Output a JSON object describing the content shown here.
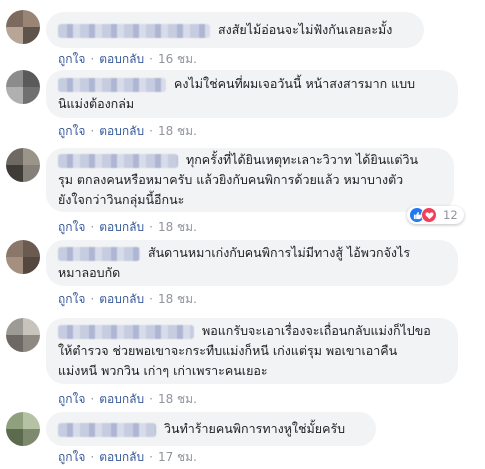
{
  "comments": [
    {
      "text": "สงสัยไม้อ่อนจะไม่ฟังกันเลยละมั้ง",
      "like_label": "ถูกใจ",
      "reply_label": "ตอบกลับ",
      "time": "16 ชม."
    },
    {
      "text_lines": [
        "คงไม่ใช่คนที่ผมเจอวันนี้ หน้าสงสารมาก แบบ",
        "นิแม่งต้องกล่ม"
      ],
      "like_label": "ถูกใจ",
      "reply_label": "ตอบกลับ",
      "time": "18 ชม."
    },
    {
      "text_lines": [
        "ทุกครั้งที่ได้ยินเหตุทะเลาะวิวาท ได้ยินแต่วิน",
        "รุม ตกลงคนหรือหมาครับ แล้วยิงกับคนพิการด้วยแล้ว หมาบางตัว",
        "ยังใจกว่าวินกลุ่มนี้อีกนะ"
      ],
      "like_label": "ถูกใจ",
      "reply_label": "ตอบกลับ",
      "time": "18 ชม.",
      "reaction_count": "12"
    },
    {
      "text_lines": [
        "สันดานหมาเก่งกับคนพิการไม่มีทางสู้ ไอ้พวกจังไร",
        "หมาลอบกัด"
      ],
      "like_label": "ถูกใจ",
      "reply_label": "ตอบกลับ",
      "time": "18 ชม."
    },
    {
      "text_lines": [
        "พอแกรับจะเอาเรื่องจะเถื่อนกลับแม่งก็ไปขอ",
        "ให้ตำรวจ ช่วยพอเขาจะกระทืบแม่งก็หนี เก่งแต่รุม พอเขาเอาคืน",
        "แม่งหนี พวกวิน เก่าๆ เก่าเพราะคนเยอะ"
      ],
      "like_label": "ถูกใจ",
      "reply_label": "ตอบกลับ",
      "time": "18 ชม."
    },
    {
      "text": "วินทำร้ายคนพิการทางหูใช่มั้ยครับ",
      "like_label": "ถูกใจ",
      "reply_label": "ตอบกลับ",
      "time": "17 ชม."
    }
  ],
  "colors": {
    "bubble": "#f2f3f5",
    "link": "#365899",
    "meta": "#90949c",
    "like_reaction": "#2078f4",
    "love_reaction": "#f33e58"
  },
  "icons": {
    "like_reaction": "thumbs-up-icon",
    "love_reaction": "heart-icon"
  }
}
